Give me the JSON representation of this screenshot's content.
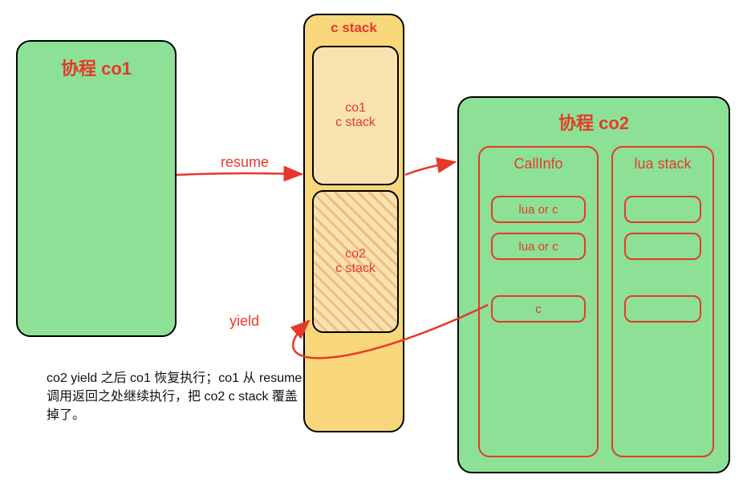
{
  "co1": {
    "title": "协程 co1"
  },
  "center": {
    "title": "c stack",
    "upper_block": "co1\nc stack",
    "lower_block": "co2\nc stack"
  },
  "co2": {
    "title": "协程 co2",
    "callinfo": {
      "header": "CallInfo",
      "slots": [
        "lua or c",
        "lua or c",
        "c"
      ]
    },
    "luastack": {
      "header": "lua stack"
    }
  },
  "arrows": {
    "resume": "resume",
    "yield": "yield"
  },
  "caption": "co2 yield 之后 co1 恢复执行；co1 从 resume 调用返回之处继续执行，把 co2 c stack 覆盖掉了。"
}
